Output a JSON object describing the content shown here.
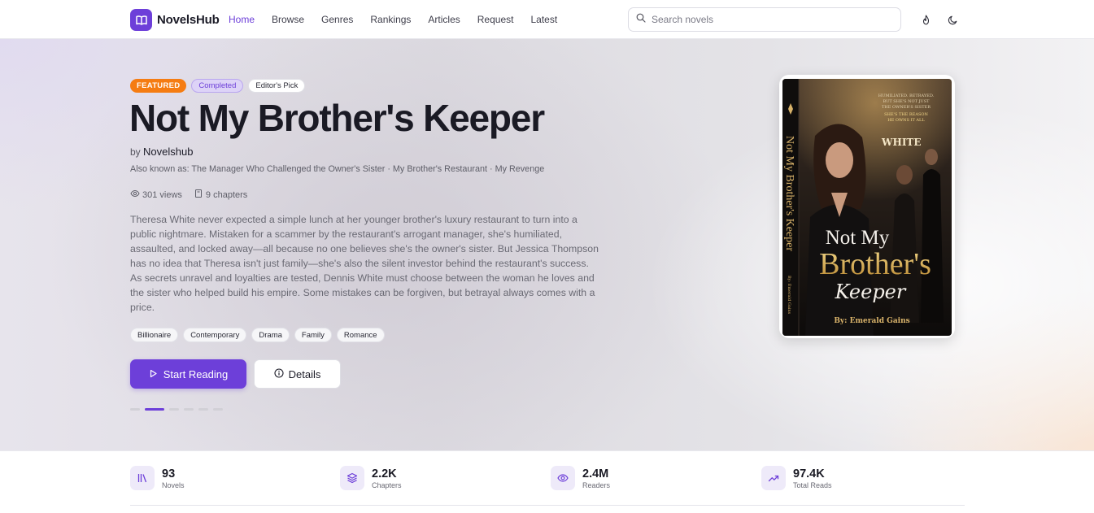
{
  "brand": {
    "name": "NovelsHub",
    "accent": "#6d3fd9"
  },
  "nav": [
    {
      "label": "Home",
      "active": true
    },
    {
      "label": "Browse"
    },
    {
      "label": "Genres"
    },
    {
      "label": "Rankings"
    },
    {
      "label": "Articles"
    },
    {
      "label": "Request"
    },
    {
      "label": "Latest"
    }
  ],
  "search": {
    "placeholder": "Search novels"
  },
  "header_icons": [
    "flame-icon",
    "moon-icon"
  ],
  "hero": {
    "badges": {
      "featured": "FEATURED",
      "completed": "Completed",
      "pick": "Editor's Pick"
    },
    "title": "Not My Brother's Keeper",
    "by_prefix": "by",
    "author": "Novelshub",
    "aka": "Also known as: The Manager Who Challenged the Owner's Sister · My Brother's Restaurant · My Revenge",
    "views": "301 views",
    "chapters": "9 chapters",
    "description": "Theresa White never expected a simple lunch at her younger brother's luxury restaurant to turn into a public nightmare. Mistaken for a scammer by the restaurant's arrogant manager, she's humiliated, assaulted, and locked away—all because no one believes she's the owner's sister. But Jessica Thompson has no idea that Theresa isn't just family—she's also the silent investor behind the restaurant's success. As secrets unravel and loyalties are tested, Dennis White must choose between the woman he loves and the sister who helped build his empire. Some mistakes can be forgiven, but betrayal always comes with a price.",
    "tags": [
      "Billionaire",
      "Contemporary",
      "Drama",
      "Family",
      "Romance"
    ],
    "start_label": "Start Reading",
    "details_label": "Details",
    "slides": {
      "count": 6,
      "active": 2
    }
  },
  "cover": {
    "blurb_lines": [
      "HUMILIATED. BETRAYED.",
      "BUT SHE'S NOT JUST",
      "THE OWNER'S SISTER",
      "SHE'S THE REASON",
      "HE OWNS IT ALL"
    ],
    "sign": "WHITE",
    "title_line1": "Not My",
    "title_line2": "Brother's",
    "title_line3": "Keeper",
    "author_line": "By: Emerald Gains",
    "spine_title": "Not My Brother's Keeper",
    "spine_author": "By: Emerald Gains"
  },
  "stats": [
    {
      "value": "93",
      "label": "Novels",
      "icon": "library-icon"
    },
    {
      "value": "2.2K",
      "label": "Chapters",
      "icon": "layers-icon"
    },
    {
      "value": "2.4M",
      "label": "Readers",
      "icon": "eye-icon"
    },
    {
      "value": "97.4K",
      "label": "Total Reads",
      "icon": "trending-up-icon"
    }
  ]
}
